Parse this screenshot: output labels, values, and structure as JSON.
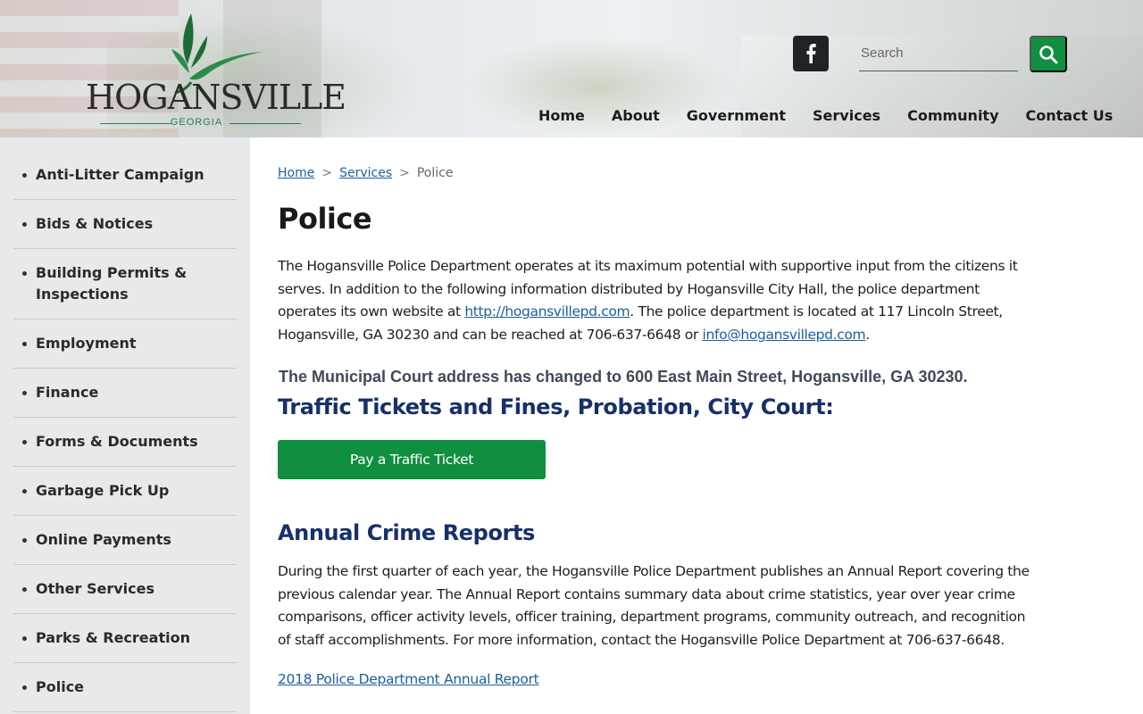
{
  "header": {
    "logo_text": "HOGANSVILLE",
    "logo_sub": "GEORGIA",
    "search_placeholder": "Search",
    "nav": [
      "Home",
      "About",
      "Government",
      "Services",
      "Community",
      "Contact Us"
    ]
  },
  "sidebar": {
    "items": [
      "Anti-Litter Campaign",
      "Bids & Notices",
      "Building Permits & Inspections",
      "Employment",
      "Finance",
      "Forms & Documents",
      "Garbage Pick Up",
      "Online Payments",
      "Other Services",
      "Parks & Recreation",
      "Police"
    ]
  },
  "breadcrumb": {
    "home": "Home",
    "services": "Services",
    "current": "Police",
    "separator": ">"
  },
  "main": {
    "title": "Police",
    "intro": {
      "text1": "The Hogansville Police Department operates at its maximum potential with supportive input from the citizens it serves. In addition to the following information distributed by Hogansville City Hall, the police department operates its own website at ",
      "link1": "http://hogansvillepd.com",
      "text2": ". The police department is located at 117 Lincoln Street, Hogansville, GA 30230 and can be reached at 706-637-6648 or ",
      "link2": "info@hogansvillepd.com",
      "text3": "."
    },
    "notice": "The Municipal Court address has changed to 600 East Main Street, Hogansville, GA  30230.",
    "traffic_heading": "Traffic Tickets and Fines, Probation, City Court:",
    "pay_button": "Pay a Traffic Ticket",
    "reports_heading": "Annual Crime Reports",
    "reports_text": "During the first quarter of each year, the Hogansville Police Department publishes an Annual Report covering the previous calendar year. The Annual Report contains summary data about crime statistics, year over year crime comparisons, officer activity levels, officer training, department programs, community outreach, and recognition of staff accomplishments. For more information, contact the Hogansville Police Department at 706-637-6648.",
    "report_link": "2018 Police Department Annual Report"
  },
  "colors": {
    "brand_green": "#0f8f3f",
    "heading_blue": "#16306a",
    "link_blue": "#1b5e9e",
    "sidebar_bg": "#e8e9ea"
  }
}
